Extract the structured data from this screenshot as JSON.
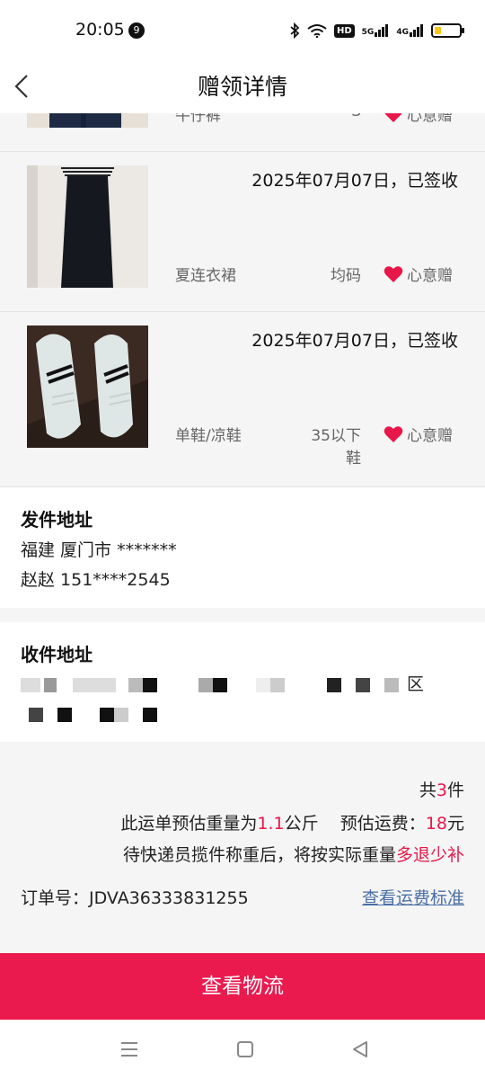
{
  "status_bar": {
    "time": "20:05",
    "notification_count": "9",
    "hd_label": "HD",
    "net1": "5G",
    "net2": "4G",
    "battery_level": 0.28,
    "battery_color": "#f5c518"
  },
  "header": {
    "title": "赠领详情"
  },
  "items": [
    {
      "date": "",
      "name": "牛仔裤",
      "size": "S",
      "tag": "心意赠"
    },
    {
      "date": "2025年07月07日，已签收",
      "name": "夏连衣裙",
      "size": "均码",
      "tag": "心意赠"
    },
    {
      "date": "2025年07月07日，已签收",
      "name": "单鞋/凉鞋",
      "size": "35以下鞋",
      "tag": "心意赠"
    }
  ],
  "sender": {
    "title": "发件地址",
    "address": "福建 厦门市 *******",
    "contact": "赵赵 151****2545"
  },
  "receiver": {
    "title": "收件地址",
    "address_tail": "区"
  },
  "summary": {
    "count_prefix": "共",
    "count": "3",
    "count_suffix": "件",
    "weight_prefix": "此运单预估重量为",
    "weight": "1.1",
    "weight_unit": "公斤",
    "fee_prefix": "预估运费：",
    "fee": "18",
    "fee_unit": "元",
    "note_prefix": "待快递员揽件称重后，将按实际重量",
    "note_highlight": "多退少补",
    "order_label": "订单号：",
    "order_no": "JDVA36333831255",
    "fee_link": "查看运费标准"
  },
  "cta": {
    "label": "查看物流"
  },
  "colors": {
    "accent": "#ea1a4f",
    "highlight": "#e8174a",
    "link": "#4a6fa5"
  }
}
